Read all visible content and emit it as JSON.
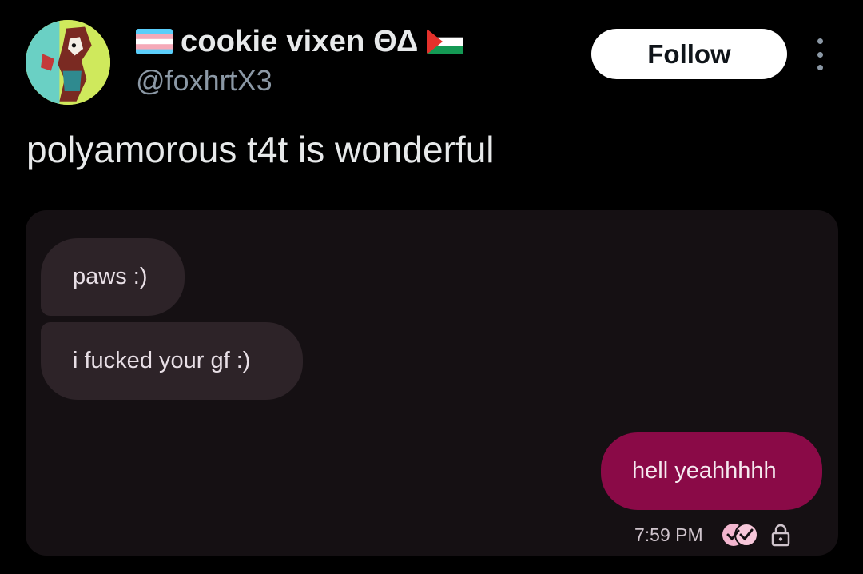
{
  "author": {
    "display_name": "cookie vixen ΘΔ",
    "handle": "@foxhrtX3",
    "avatar_icon": "fox-avatar",
    "name_flags": [
      "transgender-flag",
      "palestine-flag"
    ]
  },
  "actions": {
    "follow_label": "Follow",
    "more_icon": "more-vertical-icon"
  },
  "post": {
    "text": "polyamorous t4t is wonderful"
  },
  "screenshot": {
    "messages": [
      {
        "direction": "incoming",
        "text": "paws :)"
      },
      {
        "direction": "incoming",
        "text": "i fucked your gf :)"
      },
      {
        "direction": "outgoing",
        "text": "hell yeahhhhh"
      }
    ],
    "timestamp": "7:59 PM",
    "status_icons": [
      "read-receipt-icon",
      "lock-icon"
    ],
    "colors": {
      "outgoing_bubble": "#8a0a47",
      "incoming_bubble": "#2d2328",
      "background": "#151013"
    }
  }
}
